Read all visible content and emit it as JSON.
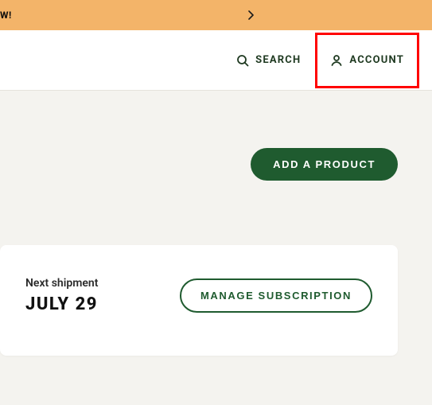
{
  "banner": {
    "partial_text": "W!",
    "chevron_icon": "chevron-right"
  },
  "header": {
    "search_label": "SEARCH",
    "account_label": "ACCOUNT"
  },
  "main": {
    "add_product_label": "ADD A PRODUCT"
  },
  "card": {
    "shipment_label": "Next shipment",
    "shipment_date": "JULY 29",
    "manage_label": "MANAGE SUBSCRIPTION"
  },
  "colors": {
    "banner_bg": "#f3b469",
    "brand_green": "#1f5b2f",
    "highlight_red": "#ff0000",
    "page_bg": "#f4f3ef"
  }
}
